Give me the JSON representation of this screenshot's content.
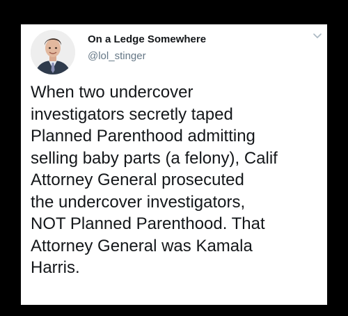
{
  "tweet": {
    "author": {
      "display_name": "On a Ledge Somewhere",
      "handle": "@lol_stinger",
      "avatar_icon": "profile-photo"
    },
    "menu_icon": "chevron-down-icon",
    "text_lines": [
      "When two undercover",
      "investigators secretly taped",
      "Planned Parenthood admitting",
      "selling baby parts (a felony), Calif",
      "Attorney General prosecuted",
      "the undercover investigators,",
      "NOT Planned Parenthood. That",
      "Attorney General was Kamala",
      "Harris."
    ]
  },
  "colors": {
    "background": "#000000",
    "card": "#ffffff",
    "text": "#14171a",
    "secondary_text": "#657786"
  }
}
